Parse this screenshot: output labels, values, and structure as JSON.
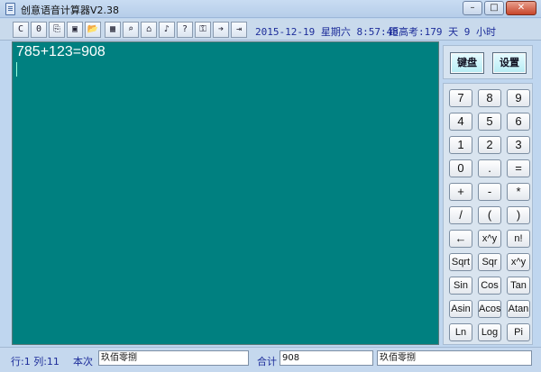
{
  "window": {
    "title": "创意语音计算器V2.38",
    "minimize": "–",
    "maximize": "□",
    "close": "✕"
  },
  "toolbar": {
    "buttons": [
      {
        "id": "c",
        "label": "C",
        "icon": "clear-icon"
      },
      {
        "id": "zero",
        "label": "0",
        "icon": "zero-icon"
      },
      {
        "id": "copy",
        "label": "⎘",
        "icon": "copy-icon"
      },
      {
        "id": "save",
        "label": "▣",
        "icon": "save-icon"
      },
      {
        "id": "open",
        "label": "📂",
        "icon": "folder-icon"
      },
      {
        "id": "calendar",
        "label": "▦",
        "icon": "calendar-icon"
      },
      {
        "id": "find",
        "label": "⌕",
        "icon": "search-icon"
      },
      {
        "id": "home",
        "label": "⌂",
        "icon": "home-icon"
      },
      {
        "id": "voice",
        "label": "♪",
        "icon": "speaker-icon"
      },
      {
        "id": "help",
        "label": "?",
        "icon": "help-icon"
      },
      {
        "id": "key",
        "label": "⚿",
        "icon": "key-icon"
      },
      {
        "id": "next",
        "label": "➔",
        "icon": "arrow-right-icon"
      },
      {
        "id": "exit",
        "label": "⇥",
        "icon": "exit-icon"
      }
    ],
    "datetime": "2015-12-19 星期六 8:57:48",
    "countdown": "距高考:179 天 9 小时"
  },
  "display": {
    "expression": "785+123=908"
  },
  "panel": {
    "keyboard_btn": "键盘",
    "settings_btn": "设置"
  },
  "keypad": {
    "keys": [
      "7",
      "8",
      "9",
      "4",
      "5",
      "6",
      "1",
      "2",
      "3",
      "0",
      ".",
      "=",
      "+",
      "-",
      "*",
      "/",
      "(",
      ")",
      "←",
      "x^y",
      "n!",
      "Sqrt",
      "Sqr",
      "x^y",
      "Sin",
      "Cos",
      "Tan",
      "Asin",
      "Acos",
      "Atan",
      "Ln",
      "Log",
      "Pi"
    ]
  },
  "statusbar": {
    "position_label": "行:1 列:11",
    "current_label": "本次",
    "current_value": "玖佰零捌",
    "total_label": "合计",
    "total_value": "908",
    "total_words": "玖佰零捌"
  }
}
